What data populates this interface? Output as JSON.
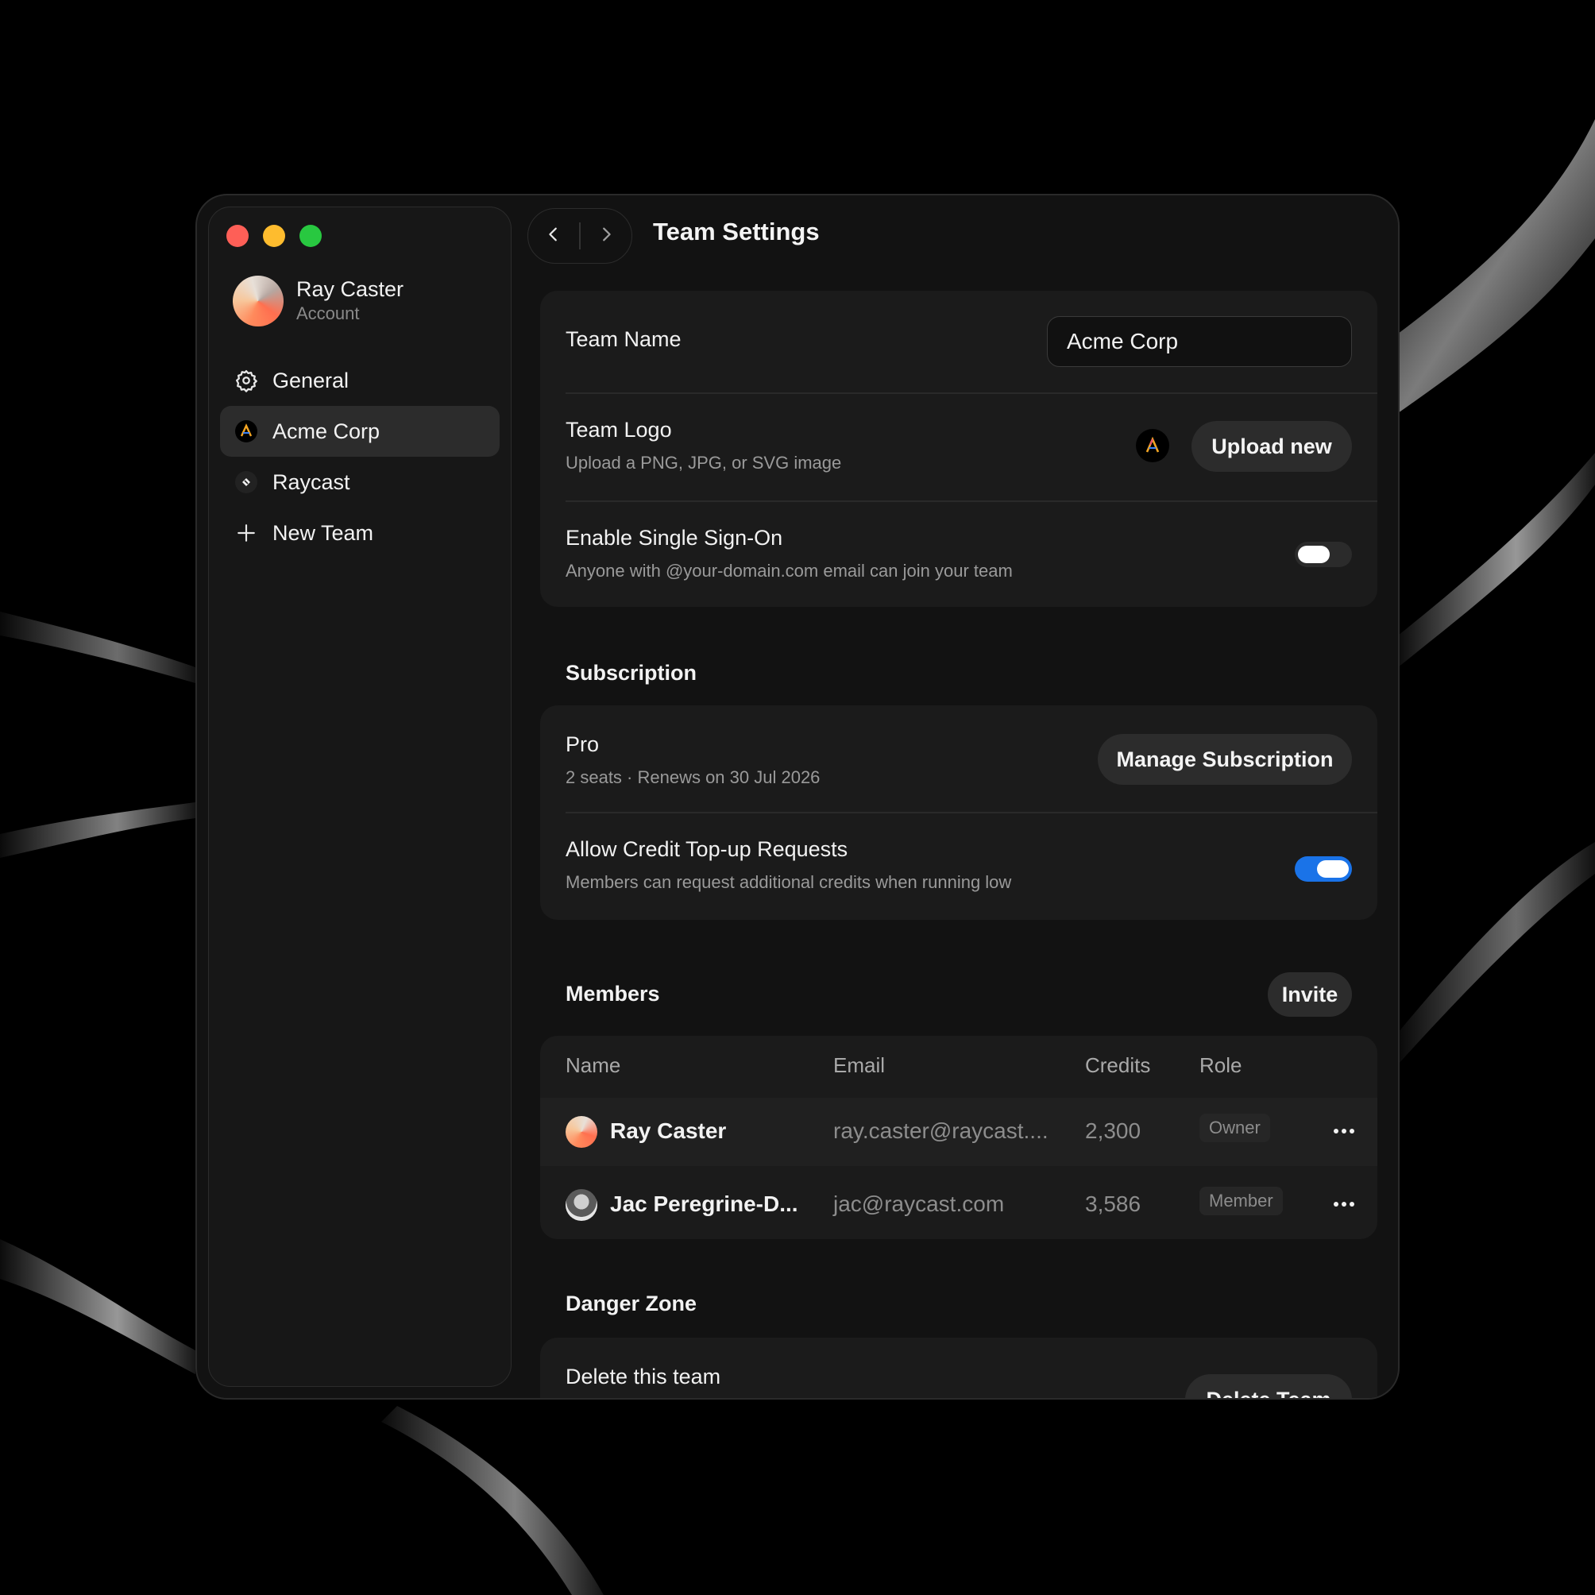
{
  "window": {
    "traffic_lights": [
      "close",
      "minimize",
      "zoom"
    ]
  },
  "sidebar": {
    "account": {
      "name": "Ray Caster",
      "subtitle": "Account"
    },
    "items": [
      {
        "label": "General",
        "icon": "gear-icon",
        "active": false
      },
      {
        "label": "Acme Corp",
        "icon": "acme-logo-icon",
        "active": true
      },
      {
        "label": "Raycast",
        "icon": "raycast-logo-icon",
        "active": false
      },
      {
        "label": "New Team",
        "icon": "plus-icon",
        "active": false
      }
    ]
  },
  "header": {
    "back_icon": "chevron-left-icon",
    "forward_icon": "chevron-right-icon",
    "title": "Team Settings"
  },
  "team": {
    "name_label": "Team Name",
    "name_value": "Acme Corp",
    "logo_label": "Team Logo",
    "logo_sub": "Upload a PNG, JPG, or SVG image",
    "upload_label": "Upload new",
    "sso_label": "Enable Single Sign-On",
    "sso_sub": "Anyone with @your-domain.com email can join your team",
    "sso_enabled": false
  },
  "subscription": {
    "section_title": "Subscription",
    "plan": "Pro",
    "plan_sub": "2 seats · Renews on 30 Jul 2026",
    "manage_label": "Manage Subscription",
    "topup_label": "Allow Credit Top-up Requests",
    "topup_sub": "Members can request additional credits when running low",
    "topup_enabled": true
  },
  "members": {
    "section_title": "Members",
    "invite_label": "Invite",
    "columns": [
      "Name",
      "Email",
      "Credits",
      "Role"
    ],
    "rows": [
      {
        "name": "Ray Caster",
        "email": "ray.caster@raycast....",
        "credits": "2,300",
        "role": "Owner"
      },
      {
        "name": "Jac Peregrine-D...",
        "email": "jac@raycast.com",
        "credits": "3,586",
        "role": "Member"
      }
    ]
  },
  "danger": {
    "section_title": "Danger Zone",
    "delete_label": "Delete this team",
    "delete_button": "Delete Team"
  },
  "colors": {
    "accent": "#1a73e8",
    "window_bg": "#121212",
    "card_bg": "#1b1b1b",
    "close": "#fe5f57",
    "minimize": "#febc2e",
    "zoom": "#28c840"
  }
}
